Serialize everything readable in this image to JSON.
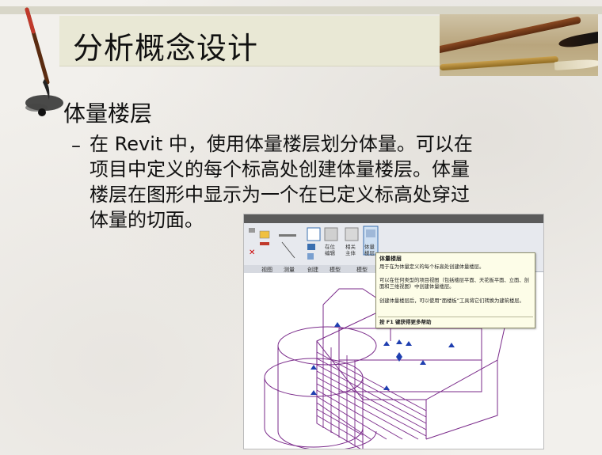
{
  "slide": {
    "title": "分析概念设计",
    "bullet": "体量楼层",
    "sub_dash": "–",
    "paragraph_lines": [
      "在 Revit 中，使用体量楼层划分体量。可以在",
      "项目中定义的每个标高处创建体量楼层。体量",
      "楼层在图形中显示为一个在已定义标高处穿过",
      "体量的切面。"
    ]
  },
  "screenshot": {
    "ribbon_buttons": {
      "in_place": "在位\n编辑",
      "face": "相关\n主体",
      "mass_floors": "体量\n楼层"
    },
    "group_labels": [
      "视图",
      "测量",
      "创建",
      "模型",
      "模型"
    ],
    "tooltip": {
      "title": "体量楼层",
      "line1": "用于在为体量定义的每个标高处创建体量楼层。",
      "line2": "可以在任何类型的项目视图（包括楼层平面、天花板平面、立面、剖面和三维视图）中创建体量楼层。",
      "line3": "创建体量楼层后，可以使用“面楼板”工具将它们转换为建筑楼层。",
      "help": "按 F1 键获得更多帮助"
    },
    "colors": {
      "model_line": "#7a2a8a",
      "control_arrow": "#1f3fb0",
      "tooltip_bg": "#fdfde8"
    }
  }
}
